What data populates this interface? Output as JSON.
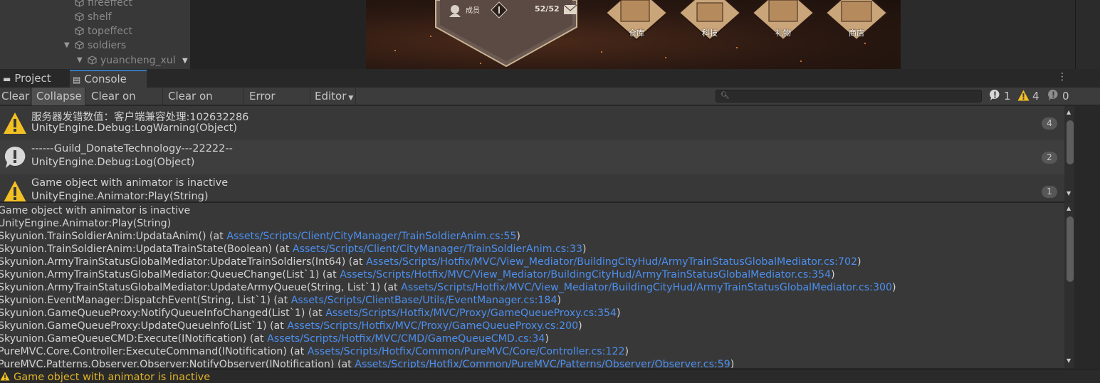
{
  "hierarchy": {
    "items": [
      {
        "label": "fireeffect"
      },
      {
        "label": "shelf"
      },
      {
        "label": "topeffect"
      },
      {
        "label": "soldiers"
      },
      {
        "label": "yuancheng_xul"
      }
    ]
  },
  "scene": {
    "member_label": "成员",
    "mail_count": "52/52",
    "buildings": [
      "仓库",
      "科技",
      "礼物",
      "商店"
    ]
  },
  "tabs": [
    {
      "label": "Project",
      "active": false
    },
    {
      "label": "Console",
      "active": true
    }
  ],
  "toolbar": {
    "clear": "Clear",
    "collapse": "Collapse",
    "clear_on_play": "Clear on Play",
    "clear_on_build": "Clear on Build",
    "error_pause": "Error Pause",
    "editor": "Editor",
    "search_value": "",
    "log_count": "1",
    "warning_count": "4",
    "error_count": "0"
  },
  "log_entries": [
    {
      "type": "warning",
      "line1": "服务器发错数值：客户端兼容处理:102632286",
      "line2": "UnityEngine.Debug:LogWarning(Object)",
      "count": "4"
    },
    {
      "type": "log",
      "line1": "------Guild_DonateTechnology---22222--",
      "line2": "UnityEngine.Debug:Log(Object)",
      "count": "2"
    },
    {
      "type": "warning",
      "line1": "Game object with animator is inactive",
      "line2": "UnityEngine.Animator:Play(String)",
      "count": "1"
    }
  ],
  "details": [
    {
      "text": "Game object with animator is inactive",
      "link": ""
    },
    {
      "text": "UnityEngine.Animator:Play(String)",
      "link": ""
    },
    {
      "text": "Skyunion.TrainSoldierAnim:UpdataAnim() (at ",
      "link": "Assets/Scripts/Client/CityManager/TrainSoldierAnim.cs:55",
      "tail": ")"
    },
    {
      "text": "Skyunion.TrainSoldierAnim:UpdataTrainState(Boolean) (at ",
      "link": "Assets/Scripts/Client/CityManager/TrainSoldierAnim.cs:33",
      "tail": ")"
    },
    {
      "text": "Skyunion.ArmyTrainStatusGlobalMediator:UpdateTrainSoldiers(Int64) (at ",
      "link": "Assets/Scripts/Hotfix/MVC/View_Mediator/BuildingCityHud/ArmyTrainStatusGlobalMediator.cs:702",
      "tail": ")"
    },
    {
      "text": "Skyunion.ArmyTrainStatusGlobalMediator:QueueChange(List`1) (at ",
      "link": "Assets/Scripts/Hotfix/MVC/View_Mediator/BuildingCityHud/ArmyTrainStatusGlobalMediator.cs:354",
      "tail": ")"
    },
    {
      "text": "Skyunion.ArmyTrainStatusGlobalMediator:UpdateArmyQueue(String, List`1) (at ",
      "link": "Assets/Scripts/Hotfix/MVC/View_Mediator/BuildingCityHud/ArmyTrainStatusGlobalMediator.cs:300",
      "tail": ")"
    },
    {
      "text": "Skyunion.EventManager:DispatchEvent(String, List`1) (at ",
      "link": "Assets/Scripts/ClientBase/Utils/EventManager.cs:184",
      "tail": ")"
    },
    {
      "text": "Skyunion.GameQueueProxy:NotifyQueueInfoChanged(List`1) (at ",
      "link": "Assets/Scripts/Hotfix/MVC/Proxy/GameQueueProxy.cs:354",
      "tail": ")"
    },
    {
      "text": "Skyunion.GameQueueProxy:UpdateQueueInfo(List`1) (at ",
      "link": "Assets/Scripts/Hotfix/MVC/Proxy/GameQueueProxy.cs:200",
      "tail": ")"
    },
    {
      "text": "Skyunion.GameQueueCMD:Execute(INotification) (at ",
      "link": "Assets/Scripts/Hotfix/MVC/CMD/GameQueueCMD.cs:34",
      "tail": ")"
    },
    {
      "text": "PureMVC.Core.Controller:ExecuteCommand(INotification) (at ",
      "link": "Assets/Scripts/Hotfix/Common/PureMVC/Core/Controller.cs:122",
      "tail": ")"
    },
    {
      "text": "PureMVC.Patterns.Observer.Observer:NotifyObserver(INotification) (at ",
      "link": "Assets/Scripts/Hotfix/Common/PureMVC/Patterns/Observer/Observer.cs:59",
      "tail": ")"
    }
  ],
  "status_bar": {
    "message": "Game object with animator is inactive"
  },
  "colors": {
    "link": "#4c8fef",
    "warning": "#f3c023",
    "accent_tab": "#3a79bb"
  }
}
